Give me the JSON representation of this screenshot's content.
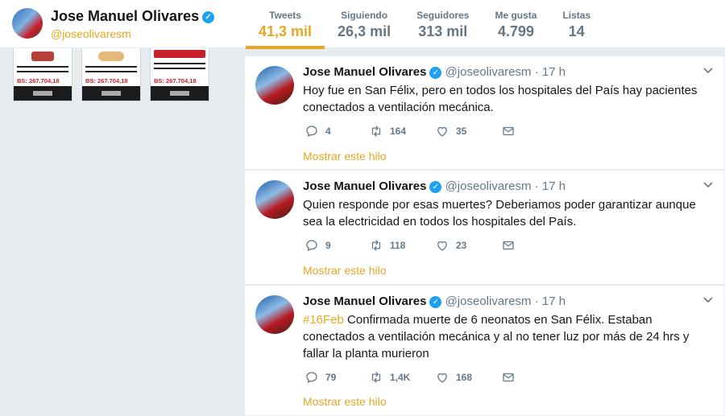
{
  "profile": {
    "name": "Jose Manuel Olivares",
    "handle": "@joseolivaresm"
  },
  "stats": [
    {
      "label": "Tweets",
      "value": "41,3 mil"
    },
    {
      "label": "Siguiendo",
      "value": "26,3 mil"
    },
    {
      "label": "Seguidores",
      "value": "313 mil"
    },
    {
      "label": "Me gusta",
      "value": "4.799"
    },
    {
      "label": "Listas",
      "value": "14"
    }
  ],
  "media": {
    "thumbs": [
      {
        "price": "BS: 267.704,18"
      },
      {
        "price": "BS: 267.704,18"
      },
      {
        "price": "BS: 267.704,18"
      }
    ]
  },
  "tweets": [
    {
      "name": "Jose Manuel Olivares",
      "handle": "@joseolivaresm",
      "time": "· 17 h",
      "hashtag": "",
      "text": "Hoy fue en San Félix, pero en todos los hospitales del País hay pacientes conectados a ventilación mecánica.",
      "replies": "4",
      "retweets": "164",
      "likes": "35",
      "thread": "Mostrar este hilo"
    },
    {
      "name": "Jose Manuel Olivares",
      "handle": "@joseolivaresm",
      "time": "· 17 h",
      "hashtag": "",
      "text": "Quien responde por esas muertes? Deberiamos poder garantizar aunque sea la electricidad en todos los hospitales del País.",
      "replies": "9",
      "retweets": "118",
      "likes": "23",
      "thread": "Mostrar este hilo"
    },
    {
      "name": "Jose Manuel Olivares",
      "handle": "@joseolivaresm",
      "time": "· 17 h",
      "hashtag": "#16Feb",
      "text": " Confirmada muerte de 6 neonatos en San Félix. Estaban conectados a ventilación mecánica y al no tener luz por más de 24 hrs y fallar la planta murieron",
      "replies": "79",
      "retweets": "1,4K",
      "likes": "168",
      "thread": "Mostrar este hilo"
    }
  ],
  "colors": {
    "accent": "#e8a623",
    "verified": "#1da1f2",
    "muted": "#657786",
    "background": "#e6ecf0"
  },
  "icons": [
    "verified-badge-icon",
    "reply-icon",
    "retweet-icon",
    "like-icon",
    "direct-message-icon",
    "chevron-down-icon"
  ]
}
